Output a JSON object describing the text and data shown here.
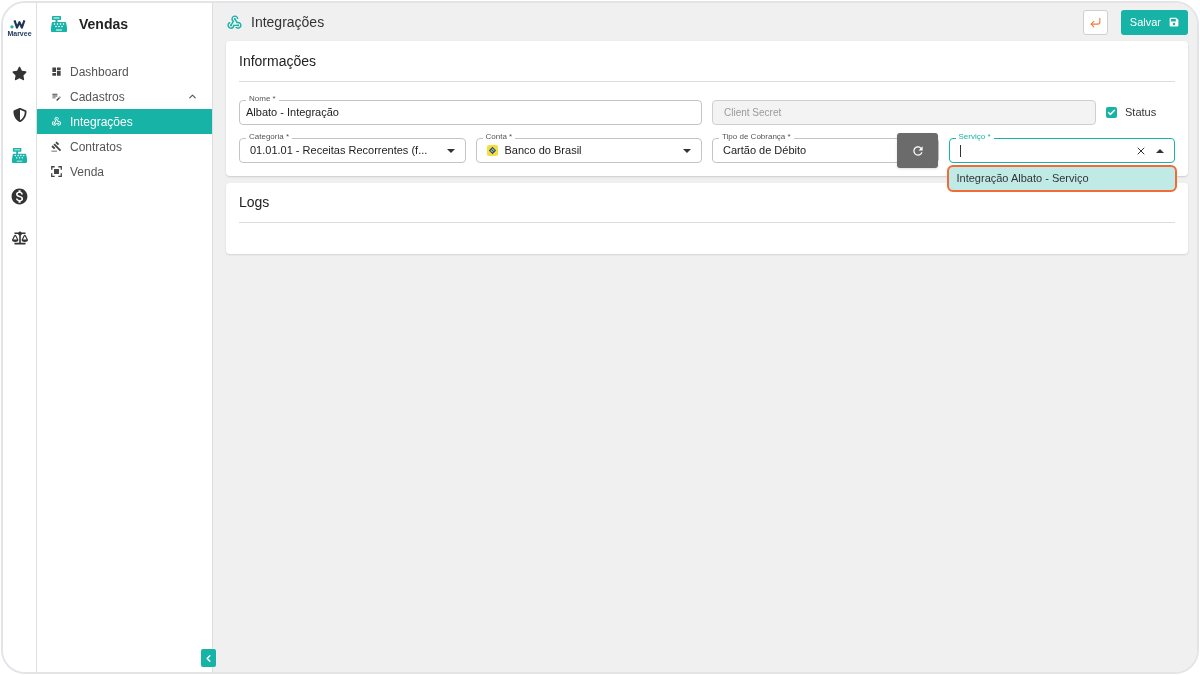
{
  "rail": {
    "logo": "Marvee",
    "items": [
      {
        "selected": false
      },
      {
        "selected": false
      },
      {
        "selected": true
      },
      {
        "selected": false
      },
      {
        "selected": false
      }
    ]
  },
  "sidebar": {
    "title": "Vendas",
    "items": [
      {
        "label": "Dashboard",
        "selected": false
      },
      {
        "label": "Cadastros",
        "selected": false,
        "expanded": true,
        "children": [
          {
            "label": "Integrações",
            "selected": true
          },
          {
            "label": "Contratos",
            "selected": false
          },
          {
            "label": "Venda",
            "selected": false
          }
        ]
      }
    ]
  },
  "header": {
    "title": "Integrações",
    "buttons": [
      {
        "kind": "back"
      },
      {
        "kind": "save",
        "label": "Salvar"
      }
    ]
  },
  "info_card": {
    "title": "Informações",
    "nome": {
      "label": "Nome *",
      "value": "Albato - Integração"
    },
    "client_secret": {
      "placeholder": "Client Secret",
      "disabled": true
    },
    "status": {
      "label": "Status",
      "checked": true
    },
    "fields": [
      {
        "kind": "select",
        "label": "Categoria *",
        "value": "01.01.01 - Receitas Recorrentes (f..."
      },
      {
        "kind": "account_select",
        "label": "Conta *",
        "value": "Banco do Brasil"
      },
      {
        "kind": "text",
        "label": "Tipo de Cobrança *",
        "value": "Cartão de Débito"
      },
      {
        "kind": "autocomplete",
        "label": "Serviço *",
        "focused": true,
        "options": [
          {
            "label": "Integração Albato - Serviço",
            "highlighted": true
          }
        ]
      }
    ]
  },
  "logs_card": {
    "title": "Logs"
  }
}
